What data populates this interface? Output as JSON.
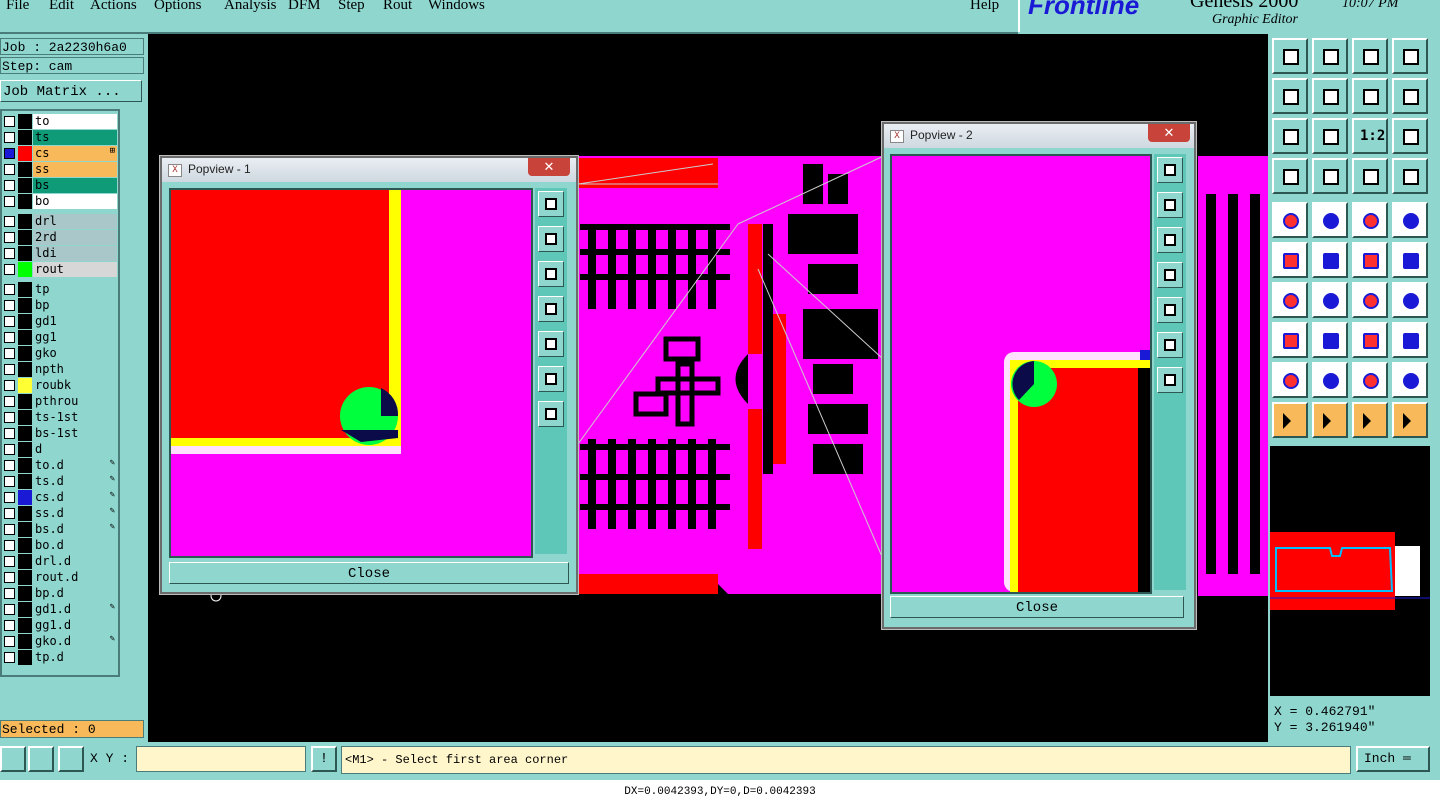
{
  "menubar": {
    "items": [
      "File",
      "Edit",
      "Actions",
      "Options",
      "Analysis",
      "DFM",
      "Step",
      "Rout",
      "Windows"
    ],
    "help": "Help"
  },
  "brand": {
    "logo": "Frontline",
    "product": "Genesis 2000",
    "subtitle": "Graphic Editor",
    "clock": "10:07 PM"
  },
  "job": {
    "job_label": "Job : 2a2230h6a0",
    "step_label": "Step: cam",
    "matrix_button": "Job Matrix ..."
  },
  "layers": [
    {
      "name": "to",
      "color": "#000000",
      "bg": "#ffffff",
      "checked": false
    },
    {
      "name": "ts",
      "color": "#000000",
      "bg": "#0f9a78",
      "checked": false
    },
    {
      "name": "cs",
      "color": "#ff0000",
      "bg": "#f7b95a",
      "checked": true,
      "icon": "⊞"
    },
    {
      "name": "ss",
      "color": "#000000",
      "bg": "#f7b95a",
      "checked": false
    },
    {
      "name": "bs",
      "color": "#000000",
      "bg": "#0f9a78",
      "checked": false
    },
    {
      "name": "bo",
      "color": "#000000",
      "bg": "#ffffff",
      "checked": false
    },
    {
      "name": "drl",
      "color": "#000000",
      "bg": "#a9c7c9",
      "checked": false
    },
    {
      "name": "2rd",
      "color": "#000000",
      "bg": "#a9c7c9",
      "checked": false
    },
    {
      "name": "ldi",
      "color": "#000000",
      "bg": "#a9c7c9",
      "checked": false
    },
    {
      "name": "rout",
      "color": "#00ff00",
      "bg": "#d7d7d7",
      "checked": false
    },
    {
      "name": "tp",
      "color": "#000000",
      "bg": "#8fd6cf",
      "checked": false
    },
    {
      "name": "bp",
      "color": "#000000",
      "bg": "#8fd6cf",
      "checked": false
    },
    {
      "name": "gd1",
      "color": "#000000",
      "bg": "#8fd6cf",
      "checked": false
    },
    {
      "name": "gg1",
      "color": "#000000",
      "bg": "#8fd6cf",
      "checked": false
    },
    {
      "name": "gko",
      "color": "#000000",
      "bg": "#8fd6cf",
      "checked": false
    },
    {
      "name": "npth",
      "color": "#000000",
      "bg": "#8fd6cf",
      "checked": false
    },
    {
      "name": "roubk",
      "color": "#ffff33",
      "bg": "#8fd6cf",
      "checked": false
    },
    {
      "name": "pthrou",
      "color": "#000000",
      "bg": "#8fd6cf",
      "checked": false
    },
    {
      "name": "ts-1st",
      "color": "#000000",
      "bg": "#8fd6cf",
      "checked": false
    },
    {
      "name": "bs-1st",
      "color": "#000000",
      "bg": "#8fd6cf",
      "checked": false
    },
    {
      "name": "d",
      "color": "#000000",
      "bg": "#8fd6cf",
      "checked": false
    },
    {
      "name": "to.d",
      "color": "#000000",
      "bg": "#8fd6cf",
      "checked": false,
      "icon": "✎"
    },
    {
      "name": "ts.d",
      "color": "#000000",
      "bg": "#8fd6cf",
      "checked": false,
      "icon": "✎"
    },
    {
      "name": "cs.d",
      "color": "#1a1ad6",
      "bg": "#8fd6cf",
      "checked": false,
      "icon": "✎"
    },
    {
      "name": "ss.d",
      "color": "#000000",
      "bg": "#8fd6cf",
      "checked": false,
      "icon": "✎"
    },
    {
      "name": "bs.d",
      "color": "#000000",
      "bg": "#8fd6cf",
      "checked": false,
      "icon": "✎"
    },
    {
      "name": "bo.d",
      "color": "#000000",
      "bg": "#8fd6cf",
      "checked": false
    },
    {
      "name": "drl.d",
      "color": "#000000",
      "bg": "#8fd6cf",
      "checked": false
    },
    {
      "name": "rout.d",
      "color": "#000000",
      "bg": "#8fd6cf",
      "checked": false
    },
    {
      "name": "bp.d",
      "color": "#000000",
      "bg": "#8fd6cf",
      "checked": false
    },
    {
      "name": "gd1.d",
      "color": "#000000",
      "bg": "#8fd6cf",
      "checked": false,
      "icon": "✎"
    },
    {
      "name": "gg1.d",
      "color": "#000000",
      "bg": "#8fd6cf",
      "checked": false
    },
    {
      "name": "gko.d",
      "color": "#000000",
      "bg": "#8fd6cf",
      "checked": false,
      "icon": "✎"
    },
    {
      "name": "tp.d",
      "color": "#000000",
      "bg": "#8fd6cf",
      "checked": false
    }
  ],
  "selected": "Selected : 0",
  "popview1": {
    "title": "Popview - 1",
    "close": "Close",
    "x_icon": "✕"
  },
  "popview2": {
    "title": "Popview - 2",
    "close": "Close",
    "x_icon": "✕"
  },
  "toolbox": {
    "rows": [
      [
        "step-up-icon",
        "step-down-icon",
        "home-icon",
        "grid-icon"
      ],
      [
        "pan-left-icon",
        "pan-right-icon",
        "swap-icon",
        "redraw-icon"
      ],
      [
        "fit-icon",
        "zoom-fit-icon",
        "scale-1-2-icon",
        "help-icon"
      ],
      [
        "palette-icon",
        "probe-icon",
        "layers-red-icon",
        "layers-red2-icon"
      ],
      [
        "feature-select-icon",
        "highlight-icon",
        "ruler-icon",
        "pad-icon"
      ],
      [
        "connect-icon",
        "cross-icon",
        "move-point-icon",
        "move-point2-icon"
      ],
      [
        "angle-icon",
        "line-icon",
        "rotate-icon",
        "mirror-icon"
      ],
      [
        "pad-edit-icon",
        "line-edit-icon",
        "copy-icon",
        "group-icon"
      ],
      [
        "arc-icon",
        "arc2-icon",
        "arc3-icon",
        "arc4-icon"
      ],
      [
        "pointer-icon",
        "pointer2-icon",
        "pointer3-icon",
        "pointer4-icon"
      ]
    ],
    "ruler_text": "1:2"
  },
  "coords": {
    "x": "X = 0.462791\"",
    "y": "Y = 3.261940\""
  },
  "cmdbar": {
    "xy_label": "X Y :",
    "xy_value": "",
    "bang": "!",
    "prompt": "<M1> - Select first area corner",
    "unit": "Inch ═"
  },
  "status": "DX=0.0042393,DY=0,D=0.0042393"
}
